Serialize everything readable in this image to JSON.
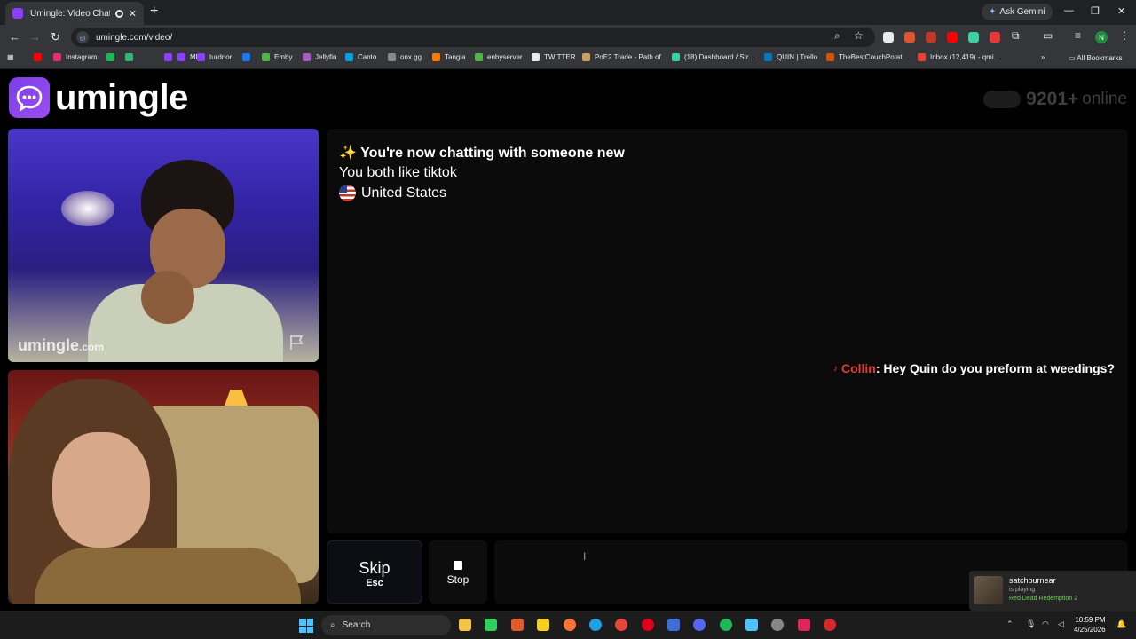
{
  "browser": {
    "tab_title": "Umingle: Video Chat with S",
    "tab_close": "✕",
    "new_tab": "+",
    "ask_gemini": "Ask Gemini",
    "window_controls": [
      "—",
      "❐",
      "✕"
    ],
    "url": "umingle.com/video/",
    "bookmarks": [
      {
        "label": "",
        "color": "#ff0000"
      },
      {
        "label": "Instagram",
        "color": "#e1306c"
      },
      {
        "label": "",
        "color": "#1db954"
      },
      {
        "label": "",
        "color": "#2eb67d"
      },
      {
        "label": "",
        "color": "#8a3ffc"
      },
      {
        "label": "ME",
        "color": "#8a3ffc"
      },
      {
        "label": "turdnor",
        "color": "#8a3ffc"
      },
      {
        "label": "",
        "color": "#1877f2"
      },
      {
        "label": "Emby",
        "color": "#52b54b"
      },
      {
        "label": "Jellyfin",
        "color": "#aa5cc3"
      },
      {
        "label": "Canto",
        "color": "#00a3e0"
      },
      {
        "label": "onx.gg",
        "color": "#888888"
      },
      {
        "label": "Tangia",
        "color": "#ff7a00"
      },
      {
        "label": "enbyserver",
        "color": "#52b54b"
      },
      {
        "label": "TWITTER",
        "color": "#e8eaed"
      },
      {
        "label": "PoE2 Trade - Path of...",
        "color": "#c8a060"
      },
      {
        "label": "(18) Dashboard / Str...",
        "color": "#3ad29f"
      },
      {
        "label": "QUIN | Trello",
        "color": "#0079bf"
      },
      {
        "label": "TheBestCouchPotat...",
        "color": "#d35400"
      },
      {
        "label": "Inbox (12,419) - qmi...",
        "color": "#ea4335"
      }
    ],
    "all_bookmarks": "All Bookmarks",
    "profile_initial": "N"
  },
  "page": {
    "logo_text": "umingle",
    "online_count": "9201",
    "online_plus": "+",
    "online_label": "online",
    "stranger_video": {
      "watermark": "umingle",
      "watermark_suffix": ".com"
    },
    "chat": {
      "line1_icon": "✨",
      "line1": "You're now chatting with someone new",
      "line2": "You both like tiktok",
      "line3": "United States",
      "message": {
        "icon": "♪",
        "name": "Collin",
        "text": ": Hey Quin do you preform at weedings?"
      }
    },
    "controls": {
      "skip_label": "Skip",
      "skip_key": "Esc",
      "stop_label": "Stop",
      "input_placeholder": ""
    }
  },
  "notification": {
    "user": "satchburnear",
    "status": "is playing",
    "game": "Red Dead Redemption 2"
  },
  "taskbar": {
    "search_label": "Search",
    "time": "10:59 PM",
    "date": "4/25/2026"
  }
}
